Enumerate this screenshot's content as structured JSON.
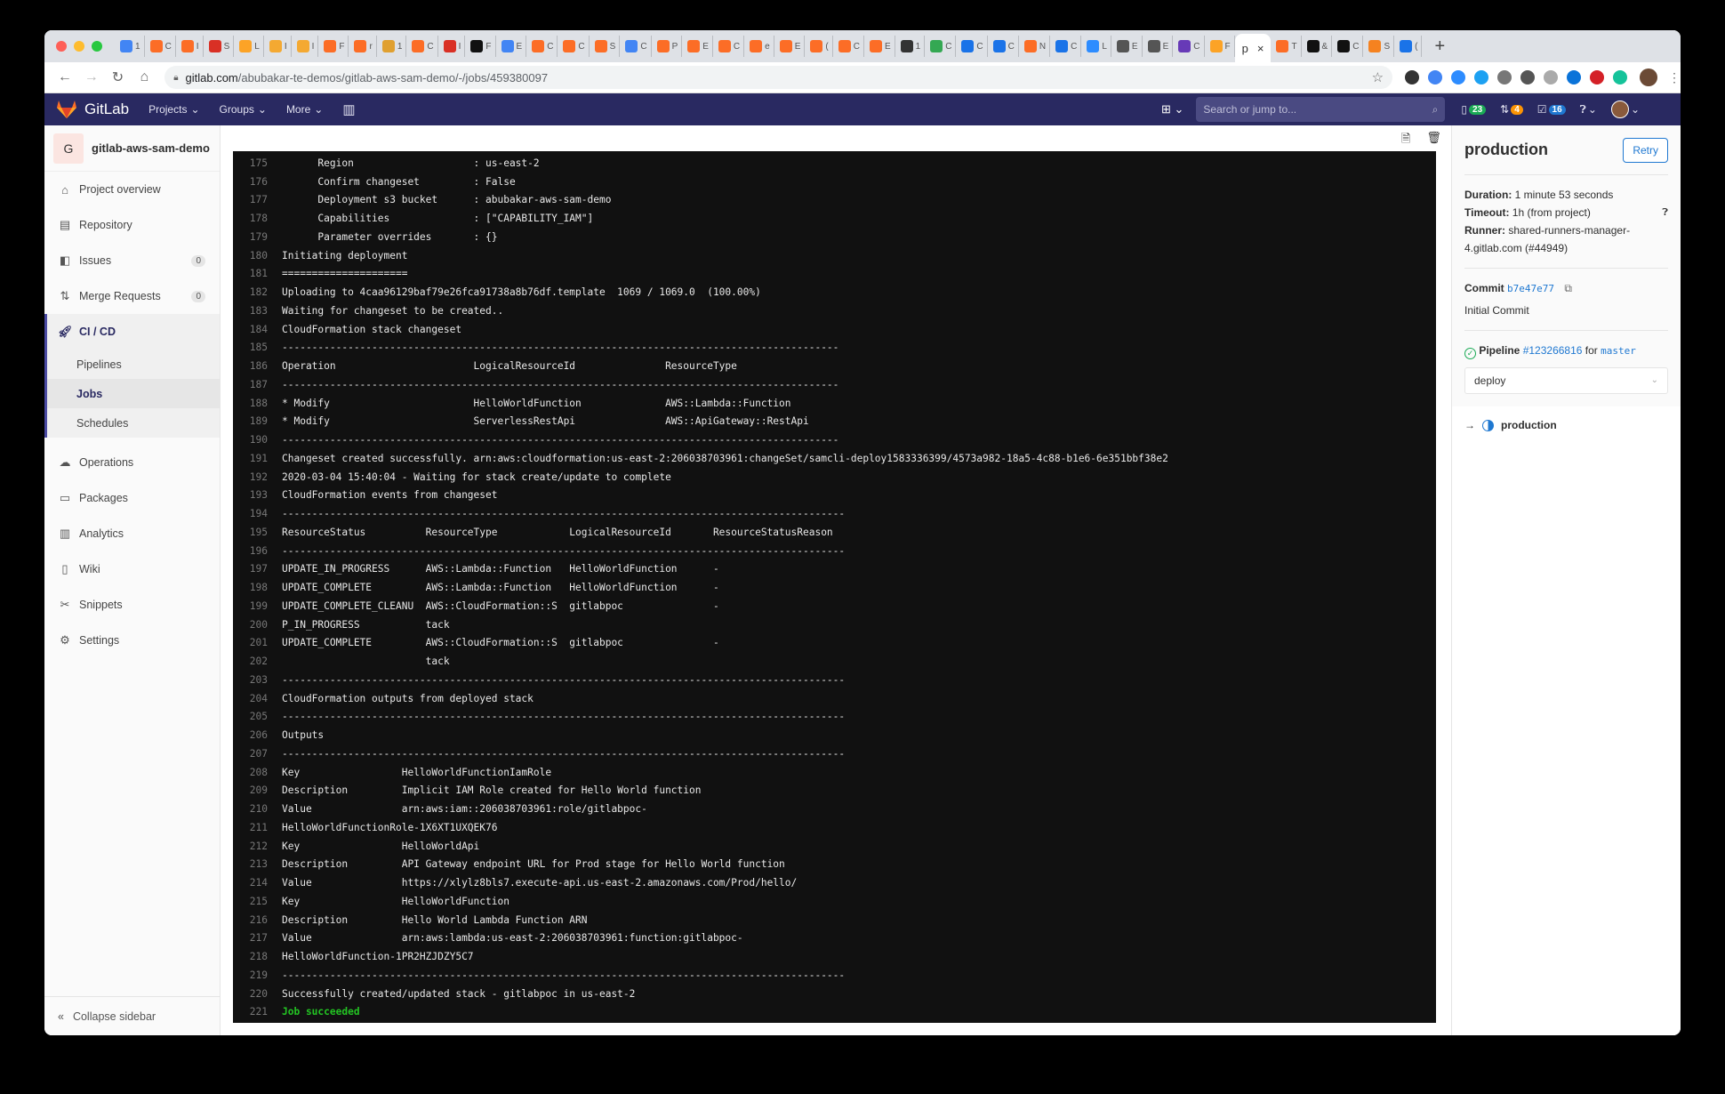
{
  "browser": {
    "tabs": [
      {
        "favicon": "google-docs",
        "color": "#4285f4",
        "label": "1"
      },
      {
        "favicon": "gitlab",
        "color": "#fc6d26",
        "label": "C"
      },
      {
        "favicon": "gitlab",
        "color": "#fc6d26",
        "label": "I"
      },
      {
        "favicon": "gmail",
        "color": "#d93025",
        "label": "S"
      },
      {
        "favicon": "gitlab-check",
        "color": "#fca326",
        "label": "L"
      },
      {
        "favicon": "book",
        "color": "#f4a932",
        "label": "I"
      },
      {
        "favicon": "book",
        "color": "#f4a932",
        "label": "I"
      },
      {
        "favicon": "gitlab",
        "color": "#fc6d26",
        "label": "F"
      },
      {
        "favicon": "gitlab",
        "color": "#fc6d26",
        "label": "r"
      },
      {
        "favicon": "people",
        "color": "#e0a030",
        "label": "1"
      },
      {
        "favicon": "gitlab",
        "color": "#fc6d26",
        "label": "C"
      },
      {
        "favicon": "gmail",
        "color": "#d93025",
        "label": "I"
      },
      {
        "favicon": "circle-dark",
        "color": "#111111",
        "label": "F"
      },
      {
        "favicon": "google-docs",
        "color": "#4285f4",
        "label": "E"
      },
      {
        "favicon": "gitlab",
        "color": "#fc6d26",
        "label": "C"
      },
      {
        "favicon": "gitlab",
        "color": "#fc6d26",
        "label": "C"
      },
      {
        "favicon": "gitlab",
        "color": "#fc6d26",
        "label": "S"
      },
      {
        "favicon": "google-docs",
        "color": "#4285f4",
        "label": "C"
      },
      {
        "favicon": "gitlab",
        "color": "#fc6d26",
        "label": "P"
      },
      {
        "favicon": "gitlab",
        "color": "#fc6d26",
        "label": "E"
      },
      {
        "favicon": "gitlab",
        "color": "#fc6d26",
        "label": "C"
      },
      {
        "favicon": "gitlab",
        "color": "#fc6d26",
        "label": "e"
      },
      {
        "favicon": "gitlab",
        "color": "#fc6d26",
        "label": "E"
      },
      {
        "favicon": "gitlab",
        "color": "#fc6d26",
        "label": "("
      },
      {
        "favicon": "gitlab",
        "color": "#fc6d26",
        "label": "C"
      },
      {
        "favicon": "gitlab",
        "color": "#fc6d26",
        "label": "E"
      },
      {
        "favicon": "panda",
        "color": "#333333",
        "label": "1"
      },
      {
        "favicon": "google-drive",
        "color": "#34a853",
        "label": "C"
      },
      {
        "favicon": "calendar",
        "color": "#1a73e8",
        "label": "C"
      },
      {
        "favicon": "calendar",
        "color": "#1a73e8",
        "label": "C"
      },
      {
        "favicon": "gitlab",
        "color": "#fc6d26",
        "label": "N"
      },
      {
        "favicon": "calendar",
        "color": "#1a73e8",
        "label": "C"
      },
      {
        "favicon": "zoom",
        "color": "#2d8cff",
        "label": "L"
      },
      {
        "favicon": "keyboard",
        "color": "#555555",
        "label": "E"
      },
      {
        "favicon": "bars",
        "color": "#555555",
        "label": "E"
      },
      {
        "favicon": "form",
        "color": "#673ab7",
        "label": "C"
      },
      {
        "favicon": "gitlab-check",
        "color": "#fca326",
        "label": "F"
      }
    ],
    "active_tab": {
      "label": "p",
      "close": "×"
    },
    "tabs_after": [
      {
        "favicon": "gitlab",
        "color": "#fc6d26",
        "label": "T"
      },
      {
        "favicon": "github",
        "color": "#111111",
        "label": "&"
      },
      {
        "favicon": "github",
        "color": "#111111",
        "label": "C"
      },
      {
        "favicon": "cube",
        "color": "#f58220",
        "label": "S"
      },
      {
        "favicon": "calendar",
        "color": "#1a73e8",
        "label": "("
      }
    ],
    "new_tab": "+",
    "url_host": "gitlab.com",
    "url_path": "/abubakar-te-demos/gitlab-aws-sam-demo/-/jobs/459380097",
    "extensions": [
      "1password",
      "google-translate",
      "zoom",
      "twitter",
      "link",
      "pocket",
      "calendar",
      "circle",
      "vivaldi",
      "grammarly"
    ],
    "extension_colors": [
      "#333333",
      "#4285f4",
      "#2d8cff",
      "#1da1f2",
      "#777777",
      "#555555",
      "#aaaaaa",
      "#0a73d9",
      "#d42027",
      "#15c39a"
    ]
  },
  "gitlab_nav": {
    "brand": "GitLab",
    "links": [
      "Projects",
      "Groups",
      "More"
    ],
    "search_placeholder": "Search or jump to...",
    "counters": [
      {
        "icon": "issues-icon",
        "count": "23",
        "color": "#1aaa55"
      },
      {
        "icon": "merge-request-icon",
        "count": "4",
        "color": "#fc9403"
      },
      {
        "icon": "todo-icon",
        "count": "16",
        "color": "#1f78d1"
      }
    ]
  },
  "sidebar": {
    "project_avatar": "G",
    "project_name": "gitlab-aws-sam-demo",
    "items_top": [
      {
        "icon": "home-icon",
        "glyph": "⌂",
        "label": "Project overview"
      },
      {
        "icon": "repository-icon",
        "glyph": "▤",
        "label": "Repository"
      },
      {
        "icon": "issues-icon",
        "glyph": "◧",
        "label": "Issues",
        "count": "0"
      },
      {
        "icon": "merge-request-icon",
        "glyph": "⇅",
        "label": "Merge Requests",
        "count": "0"
      }
    ],
    "cicd": {
      "label": "CI / CD",
      "sub": [
        "Pipelines",
        "Jobs",
        "Schedules"
      ],
      "active": "Jobs"
    },
    "items_bottom": [
      {
        "icon": "operations-icon",
        "glyph": "☁",
        "label": "Operations"
      },
      {
        "icon": "packages-icon",
        "glyph": "▭",
        "label": "Packages"
      },
      {
        "icon": "analytics-icon",
        "glyph": "▥",
        "label": "Analytics"
      },
      {
        "icon": "wiki-icon",
        "glyph": "▯",
        "label": "Wiki"
      },
      {
        "icon": "snippets-icon",
        "glyph": "✂",
        "label": "Snippets"
      },
      {
        "icon": "settings-icon",
        "glyph": "⚙",
        "label": "Settings"
      }
    ],
    "collapse_label": "Collapse sidebar"
  },
  "log": {
    "lines": [
      {
        "n": "175",
        "t": "      Region                    : us-east-2"
      },
      {
        "n": "176",
        "t": "      Confirm changeset         : False"
      },
      {
        "n": "177",
        "t": "      Deployment s3 bucket      : abubakar-aws-sam-demo"
      },
      {
        "n": "178",
        "t": "      Capabilities              : [\"CAPABILITY_IAM\"]"
      },
      {
        "n": "179",
        "t": "      Parameter overrides       : {}"
      },
      {
        "n": "180",
        "t": "Initiating deployment"
      },
      {
        "n": "181",
        "t": "====================="
      },
      {
        "n": "182",
        "t": "Uploading to 4caa96129baf79e26fca91738a8b76df.template  1069 / 1069.0  (100.00%)"
      },
      {
        "n": "183",
        "t": "Waiting for changeset to be created.."
      },
      {
        "n": "184",
        "t": "CloudFormation stack changeset"
      },
      {
        "n": "185",
        "t": "---------------------------------------------------------------------------------------------"
      },
      {
        "n": "186",
        "t": "Operation                       LogicalResourceId               ResourceType"
      },
      {
        "n": "187",
        "t": "---------------------------------------------------------------------------------------------"
      },
      {
        "n": "188",
        "t": "* Modify                        HelloWorldFunction              AWS::Lambda::Function"
      },
      {
        "n": "189",
        "t": "* Modify                        ServerlessRestApi               AWS::ApiGateway::RestApi"
      },
      {
        "n": "190",
        "t": "---------------------------------------------------------------------------------------------"
      },
      {
        "n": "191",
        "t": "Changeset created successfully. arn:aws:cloudformation:us-east-2:206038703961:changeSet/samcli-deploy1583336399/4573a982-18a5-4c88-b1e6-6e351bbf38e2"
      },
      {
        "n": "192",
        "t": "2020-03-04 15:40:04 - Waiting for stack create/update to complete"
      },
      {
        "n": "193",
        "t": "CloudFormation events from changeset"
      },
      {
        "n": "194",
        "t": "----------------------------------------------------------------------------------------------"
      },
      {
        "n": "195",
        "t": "ResourceStatus          ResourceType            LogicalResourceId       ResourceStatusReason"
      },
      {
        "n": "196",
        "t": "----------------------------------------------------------------------------------------------"
      },
      {
        "n": "197",
        "t": "UPDATE_IN_PROGRESS      AWS::Lambda::Function   HelloWorldFunction      -"
      },
      {
        "n": "198",
        "t": "UPDATE_COMPLETE         AWS::Lambda::Function   HelloWorldFunction      -"
      },
      {
        "n": "199",
        "t": "UPDATE_COMPLETE_CLEANU  AWS::CloudFormation::S  gitlabpoc               -"
      },
      {
        "n": "200",
        "t": "P_IN_PROGRESS           tack"
      },
      {
        "n": "201",
        "t": "UPDATE_COMPLETE         AWS::CloudFormation::S  gitlabpoc               -"
      },
      {
        "n": "202",
        "t": "                        tack"
      },
      {
        "n": "203",
        "t": "----------------------------------------------------------------------------------------------"
      },
      {
        "n": "204",
        "t": "CloudFormation outputs from deployed stack"
      },
      {
        "n": "205",
        "t": "----------------------------------------------------------------------------------------------"
      },
      {
        "n": "206",
        "t": "Outputs"
      },
      {
        "n": "207",
        "t": "----------------------------------------------------------------------------------------------"
      },
      {
        "n": "208",
        "t": "Key                 HelloWorldFunctionIamRole"
      },
      {
        "n": "209",
        "t": "Description         Implicit IAM Role created for Hello World function"
      },
      {
        "n": "210",
        "t": "Value               arn:aws:iam::206038703961:role/gitlabpoc-"
      },
      {
        "n": "211",
        "t": "HelloWorldFunctionRole-1X6XT1UXQEK76"
      },
      {
        "n": "212",
        "t": "Key                 HelloWorldApi"
      },
      {
        "n": "213",
        "t": "Description         API Gateway endpoint URL for Prod stage for Hello World function"
      },
      {
        "n": "214",
        "t": "Value               https://xlylz8bls7.execute-api.us-east-2.amazonaws.com/Prod/hello/"
      },
      {
        "n": "215",
        "t": "Key                 HelloWorldFunction"
      },
      {
        "n": "216",
        "t": "Description         Hello World Lambda Function ARN"
      },
      {
        "n": "217",
        "t": "Value               arn:aws:lambda:us-east-2:206038703961:function:gitlabpoc-"
      },
      {
        "n": "218",
        "t": "HelloWorldFunction-1PR2HZJDZY5C7"
      },
      {
        "n": "219",
        "t": "----------------------------------------------------------------------------------------------"
      },
      {
        "n": "220",
        "t": "Successfully created/updated stack - gitlabpoc in us-east-2"
      },
      {
        "n": "221",
        "t": "Job succeeded",
        "status": "success"
      }
    ]
  },
  "job_panel": {
    "title": "production",
    "retry_label": "Retry",
    "duration_label": "Duration:",
    "duration": "1 minute 53 seconds",
    "timeout_label": "Timeout:",
    "timeout": "1h (from project)",
    "runner_label": "Runner:",
    "runner": "shared-runners-manager-4.gitlab.com (#44949)",
    "commit_label": "Commit",
    "commit_sha": "b7e47e77",
    "commit_message": "Initial Commit",
    "pipeline_label": "Pipeline",
    "pipeline_id": "#123266816",
    "pipeline_for": "for",
    "pipeline_branch": "master",
    "stage": "deploy",
    "job_name": "production"
  }
}
